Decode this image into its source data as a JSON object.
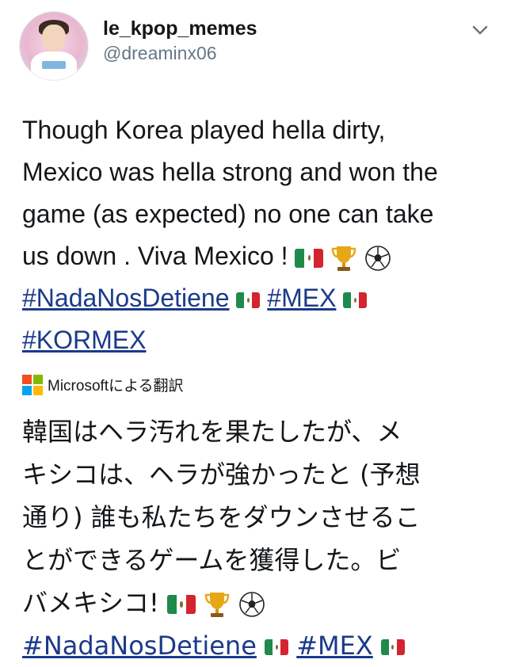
{
  "user": {
    "display_name": "le_kpop_memes",
    "handle": "@dreaminx06"
  },
  "tweet": {
    "line1": "Though Korea played hella dirty,",
    "line2": "Mexico was hella strong and won the",
    "line3": "game (as expected) no one can take",
    "line4_text": "us down . Viva Mexico ! ",
    "hashtag1": "#NadaNosDetiene",
    "hashtag2": "#MEX",
    "hashtag3": "#KORMEX"
  },
  "translation": {
    "label": "Microsoftによる翻訳",
    "logo_colors": [
      "#f25022",
      "#7fba00",
      "#00a4ef",
      "#ffb900"
    ]
  },
  "translated": {
    "line1": "韓国はヘラ汚れを果たしたが、メ",
    "line2": "キシコは、ヘラが強かったと (予想",
    "line3": "通り) 誰も私たちをダウンさせるこ",
    "line4": "とができるゲームを獲得した。ビ",
    "line5_text": "バメキシコ!",
    "hashtag1": "#NadaNosDetiene",
    "hashtag2": "#MEX"
  },
  "icons": {
    "menu": "chevron-down-icon",
    "flag": "mexico-flag-icon",
    "trophy": "trophy-icon",
    "ball": "soccer-ball-icon"
  },
  "colors": {
    "link": "#1b3a8a",
    "handle": "#657786",
    "flag_green": "#1f8a4c",
    "flag_red": "#d3242f"
  }
}
